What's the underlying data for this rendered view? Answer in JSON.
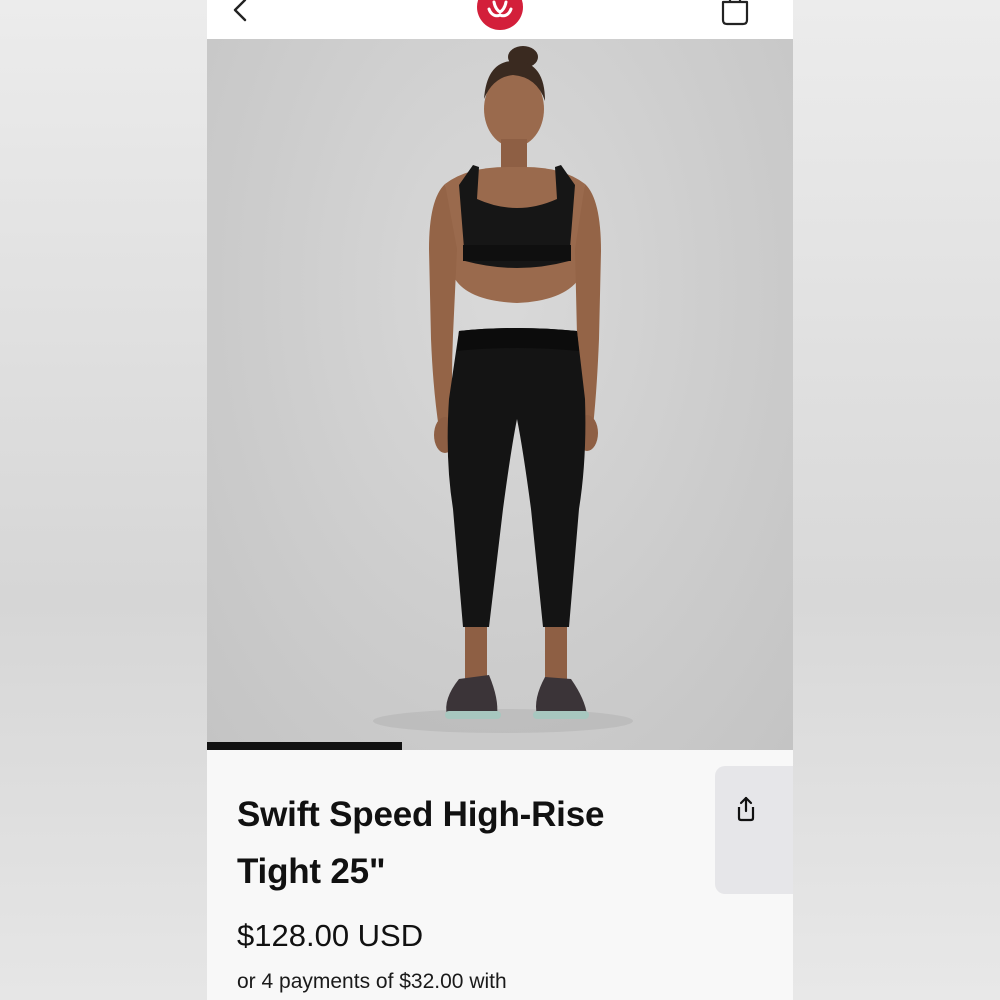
{
  "header": {
    "back_icon": "chevron-left-icon",
    "logo_icon": "lululemon-logo-icon",
    "bag_icon": "shopping-bag-icon",
    "brand_color": "#d31f3a"
  },
  "gallery": {
    "image_description": "Model wearing black sports bra and black high-rise tights",
    "progress": 0.333
  },
  "product": {
    "title": "Swift Speed High-Rise Tight 25\"",
    "price": "$128.00 USD",
    "installments": "or 4 payments of $32.00 with",
    "share_icon": "share-icon"
  }
}
